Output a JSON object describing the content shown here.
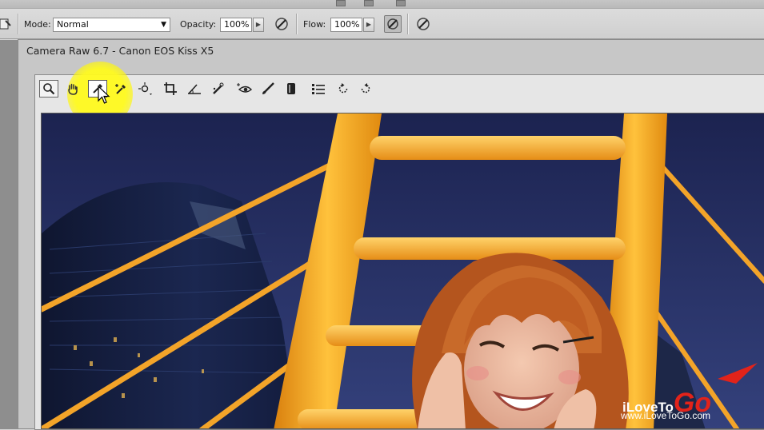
{
  "options_bar": {
    "mode_label": "Mode:",
    "mode_value": "Normal",
    "opacity_label": "Opacity:",
    "opacity_value": "100%",
    "flow_label": "Flow:",
    "flow_value": "100%"
  },
  "camera_raw": {
    "title": "Camera Raw 6.7  -  Canon EOS Kiss X5",
    "tools": [
      {
        "name": "zoom-tool",
        "icon": "magnifier-icon"
      },
      {
        "name": "hand-tool",
        "icon": "hand-icon"
      },
      {
        "name": "white-balance-tool",
        "icon": "eyedropper-icon"
      },
      {
        "name": "color-sampler-tool",
        "icon": "sampler-eyedropper-icon"
      },
      {
        "name": "targeted-adjustment-tool",
        "icon": "target-adjust-icon"
      },
      {
        "name": "crop-tool",
        "icon": "crop-icon"
      },
      {
        "name": "straighten-tool",
        "icon": "straighten-icon"
      },
      {
        "name": "spot-removal-tool",
        "icon": "spot-removal-icon"
      },
      {
        "name": "red-eye-removal-tool",
        "icon": "red-eye-icon"
      },
      {
        "name": "adjustment-brush-tool",
        "icon": "brush-icon"
      },
      {
        "name": "graduated-filter-tool",
        "icon": "graduated-filter-icon"
      },
      {
        "name": "preferences-button",
        "icon": "list-icon"
      },
      {
        "name": "rotate-left-button",
        "icon": "rotate-ccw-icon"
      },
      {
        "name": "rotate-right-button",
        "icon": "rotate-cw-icon"
      }
    ],
    "active_tool": "white-balance-tool"
  },
  "watermark": {
    "brand_prefix": "iLoveTo",
    "brand_suffix": "Go",
    "url": "www.iLoveToGo.com"
  },
  "colors": {
    "highlight": "#fff31c",
    "sky": "#283369",
    "bridge": "#f5a623",
    "brand_red": "#e2231a"
  }
}
